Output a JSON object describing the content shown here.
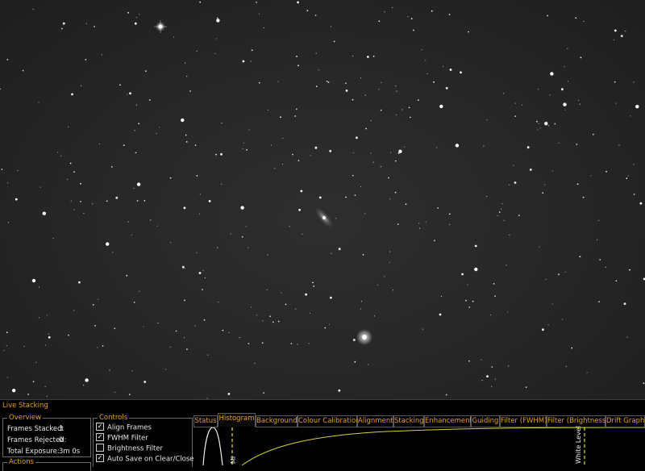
{
  "panel": {
    "title": "Live Stacking",
    "overview": {
      "label": "Overview",
      "stats": [
        {
          "label": "Frames Stacked:",
          "value": "3"
        },
        {
          "label": "Frames Rejected:",
          "value": "0"
        },
        {
          "label": "Total Exposure:",
          "value": "3m 0s"
        }
      ]
    },
    "actions_label": "Actions",
    "controls": {
      "label": "Controls",
      "items": [
        {
          "label": "Align Frames",
          "checked": true
        },
        {
          "label": "FWHM Filter",
          "checked": true
        },
        {
          "label": "Brightness Filter",
          "checked": false
        },
        {
          "label": "Auto Save on Clear/Close",
          "checked": true
        }
      ]
    },
    "tabs": [
      "Status",
      "Histogram",
      "Background",
      "Colour Calibration",
      "Alignment",
      "Stacking",
      "Enhancement",
      "Guiding",
      "Filter (FWHM)",
      "Filter (Brightness)",
      "Drift Graph"
    ],
    "active_tab": "Histogram",
    "histogram": {
      "white_level_label": "White Level",
      "mid_label": "Mi",
      "curve_color": "#d8d040",
      "marker_color": "#f0e040"
    }
  },
  "colors": {
    "accent": "#e8a020",
    "text": "#e8e8e8",
    "sky": "#262626"
  }
}
